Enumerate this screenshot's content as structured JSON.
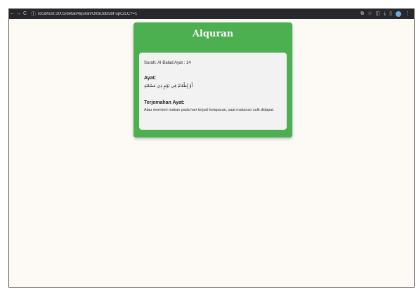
{
  "browser": {
    "url": "localhost:3001/detailAlquran/OlIbOdB5bFupc2LC?=1",
    "nav_back": "←",
    "nav_forward": "→",
    "nav_reload": "C",
    "info_icon": "ⓘ",
    "icons": [
      "install-icon",
      "star-icon",
      "extensions-icon",
      "download-icon",
      "sidebar-icon",
      "profile-icon",
      "menu-icon"
    ]
  },
  "card": {
    "title": "Alquran",
    "surah_line": "Surah: Al-Balad Ayat : 14",
    "ayat_label": "Ayat:",
    "arabic_text": "أَوْ إِطْعَامٌ فِي يَوْمٍ ذِي مَسْغَبَةٍ",
    "terjemahan_label": "Terjemahan Ayat:",
    "terjemahan_text": "Atau memberi makan pada hari terjadi kelaparan, saat makanan sulit didapat."
  },
  "colors": {
    "card_bg": "#4caf50",
    "panel_bg": "#f2f2f2",
    "page_bg": "#fdfaf6",
    "toolbar_bg": "#26282b"
  }
}
